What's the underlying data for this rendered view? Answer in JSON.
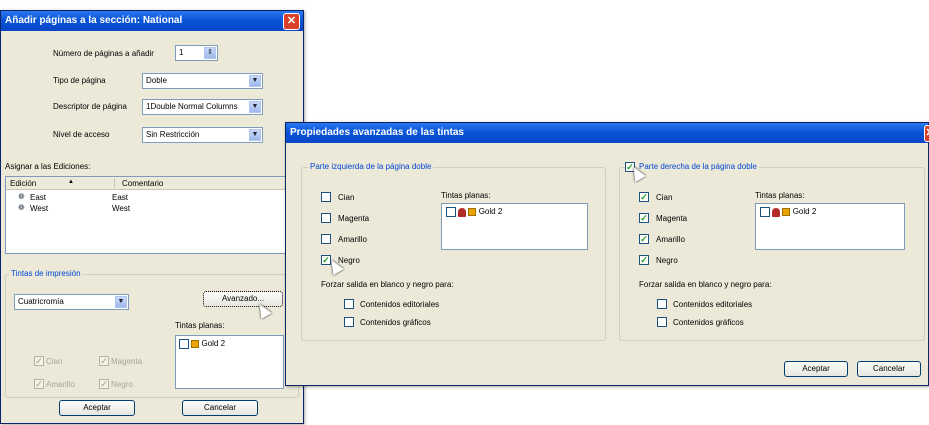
{
  "dialog1": {
    "title": "Añadir páginas a la sección:  National",
    "num_pages_label": "Número de páginas a añadir",
    "num_pages_value": "1",
    "page_type_label": "Tipo de página",
    "page_type_value": "Doble",
    "descriptor_label": "Descriptor de página",
    "descriptor_value": "1Double Normal Columns",
    "access_label": "Nivel de acceso",
    "access_value": "Sin Restricción",
    "assign_label": "Asignar a las Ediciones:",
    "col_edition": "Edición",
    "col_comment": "Comentario",
    "editions": [
      {
        "name": "East",
        "comment": "East"
      },
      {
        "name": "West",
        "comment": "West"
      }
    ],
    "inks_group": "Tintas de impresión",
    "inks_mode": "Cuatricromía",
    "advanced_button": "Avanzado...",
    "spot_label": "Tintas planas:",
    "spot_item": "Gold 2",
    "cyan": "Cian",
    "magenta": "Magenta",
    "yellow": "Amarillo",
    "black": "Negro",
    "ok": "Aceptar",
    "cancel": "Cancelar"
  },
  "dialog2": {
    "title": "Propiedades avanzadas de las tintas",
    "left_group": "Parte izquierda de la página doble",
    "right_group": "Parte derecha de la página doble",
    "cyan": "Cian",
    "magenta": "Magenta",
    "yellow": "Amarillo",
    "black": "Negro",
    "spot_label": "Tintas planas:",
    "spot_item": "Gold 2",
    "bw_label": "Forzar salida en blanco y negro para:",
    "editorial": "Contenidos editoriales",
    "graphics": "Contenidos gráficos",
    "ok": "Aceptar",
    "cancel": "Cancelar"
  },
  "colors": {
    "accent": "#0046d5",
    "title_bar": "#0a55d8",
    "swatch": "#e8a400"
  }
}
